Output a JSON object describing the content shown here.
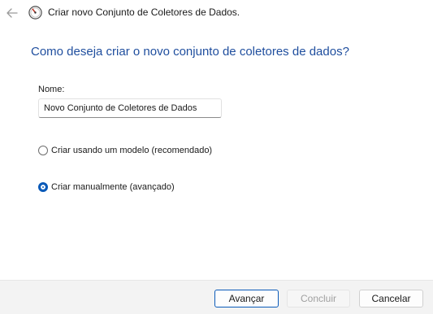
{
  "window": {
    "title": "Criar novo Conjunto de Coletores de Dados."
  },
  "main": {
    "heading": "Como deseja criar o novo conjunto de coletores de dados?",
    "name_label": "Nome:",
    "name_value": "Novo Conjunto de Coletores de Dados",
    "options": [
      {
        "label": "Criar usando um modelo (recomendado)",
        "selected": false
      },
      {
        "label": "Criar manualmente (avançado)",
        "selected": true
      }
    ]
  },
  "footer": {
    "next_label": "Avançar",
    "finish_label": "Concluir",
    "cancel_label": "Cancelar"
  },
  "icons": {
    "back": "back-arrow-icon",
    "app": "performance-monitor-icon"
  },
  "colors": {
    "heading": "#1f4e9e",
    "accent": "#0a5ab8",
    "footer_bg": "#f3f3f3",
    "disabled_text": "#a0a0a0"
  }
}
